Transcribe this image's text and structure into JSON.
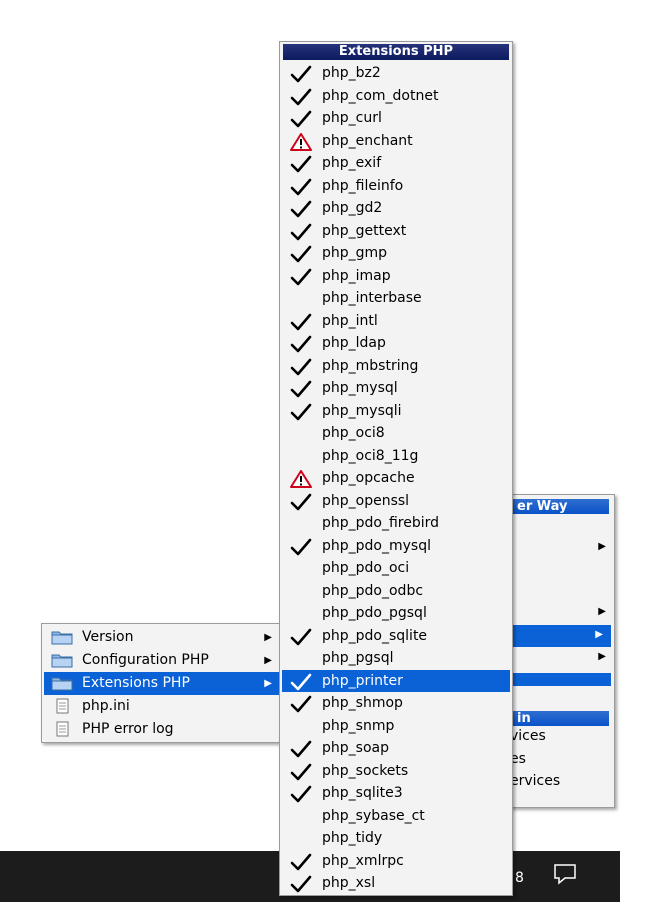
{
  "left_menu": {
    "items": [
      {
        "label": "Version",
        "icon": "folder-icon",
        "submenu": true
      },
      {
        "label": "Configuration PHP",
        "icon": "folder-icon",
        "submenu": true
      },
      {
        "label": "Extensions PHP",
        "icon": "folder-icon",
        "submenu": true,
        "highlighted": true
      },
      {
        "label": "php.ini",
        "icon": "file-icon",
        "submenu": false
      },
      {
        "label": "PHP error log",
        "icon": "file-icon",
        "submenu": false
      }
    ]
  },
  "background_menu": {
    "header1": "er Way",
    "header2": "in",
    "texts": [
      "vices",
      "es",
      "ervices"
    ]
  },
  "extensions_menu": {
    "title": "Extensions PHP",
    "items": [
      {
        "label": "php_bz2",
        "status": "checked"
      },
      {
        "label": "php_com_dotnet",
        "status": "checked"
      },
      {
        "label": "php_curl",
        "status": "checked"
      },
      {
        "label": "php_enchant",
        "status": "warning"
      },
      {
        "label": "php_exif",
        "status": "checked"
      },
      {
        "label": "php_fileinfo",
        "status": "checked"
      },
      {
        "label": "php_gd2",
        "status": "checked"
      },
      {
        "label": "php_gettext",
        "status": "checked"
      },
      {
        "label": "php_gmp",
        "status": "checked"
      },
      {
        "label": "php_imap",
        "status": "checked"
      },
      {
        "label": "php_interbase",
        "status": "none"
      },
      {
        "label": "php_intl",
        "status": "checked"
      },
      {
        "label": "php_ldap",
        "status": "checked"
      },
      {
        "label": "php_mbstring",
        "status": "checked"
      },
      {
        "label": "php_mysql",
        "status": "checked"
      },
      {
        "label": "php_mysqli",
        "status": "checked"
      },
      {
        "label": "php_oci8",
        "status": "none"
      },
      {
        "label": "php_oci8_11g",
        "status": "none"
      },
      {
        "label": "php_opcache",
        "status": "warning"
      },
      {
        "label": "php_openssl",
        "status": "checked"
      },
      {
        "label": "php_pdo_firebird",
        "status": "none"
      },
      {
        "label": "php_pdo_mysql",
        "status": "checked"
      },
      {
        "label": "php_pdo_oci",
        "status": "none"
      },
      {
        "label": "php_pdo_odbc",
        "status": "none"
      },
      {
        "label": "php_pdo_pgsql",
        "status": "none"
      },
      {
        "label": "php_pdo_sqlite",
        "status": "checked"
      },
      {
        "label": "php_pgsql",
        "status": "none"
      },
      {
        "label": "php_printer",
        "status": "checked",
        "highlighted": true
      },
      {
        "label": "php_shmop",
        "status": "checked"
      },
      {
        "label": "php_snmp",
        "status": "none"
      },
      {
        "label": "php_soap",
        "status": "checked"
      },
      {
        "label": "php_sockets",
        "status": "checked"
      },
      {
        "label": "php_sqlite3",
        "status": "checked"
      },
      {
        "label": "php_sybase_ct",
        "status": "none"
      },
      {
        "label": "php_tidy",
        "status": "none"
      },
      {
        "label": "php_xmlrpc",
        "status": "checked"
      },
      {
        "label": "php_xsl",
        "status": "checked"
      }
    ]
  },
  "taskbar": {
    "clock_fragment": "8",
    "icon": "notification-chat-icon"
  },
  "colors": {
    "highlight": "#0a62d6",
    "title_bar": "#0c1a5e",
    "menu_bg": "#f3f3f3",
    "taskbar": "#1c1c1c"
  }
}
